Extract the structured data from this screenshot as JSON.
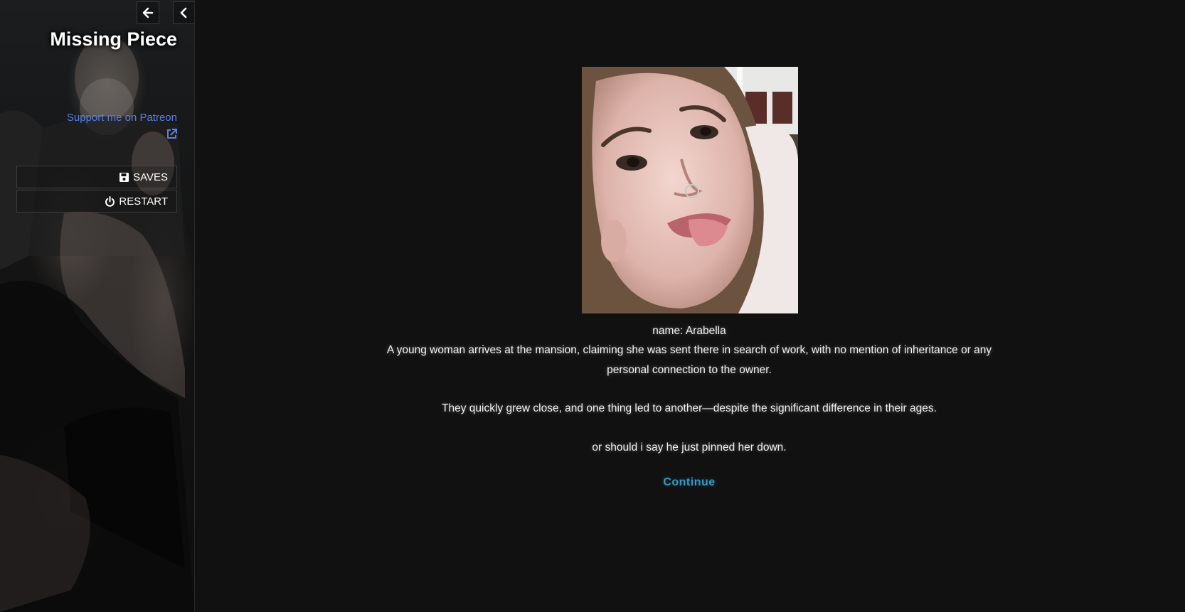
{
  "sidebar": {
    "title": "Missing Piece",
    "patreon_link": "Support me on Patreon",
    "menu": {
      "saves_label": "SAVES",
      "restart_label": "RESTART"
    },
    "icons": {
      "back": "arrow-left-icon",
      "collapse": "chevron-left-icon",
      "external_link": "external-link-icon",
      "saves": "floppy-disk-icon",
      "restart": "power-icon"
    }
  },
  "passage": {
    "name_line": "name: Arabella",
    "paragraphs": [
      "A young woman arrives at the mansion, claiming she was sent there in search of work, with no mention of inheritance or any personal connection to the owner.",
      "They quickly grew close, and one thing led to another—despite the significant difference in their ages.",
      "or should i say he just pinned her down."
    ],
    "continue_label": "Continue"
  },
  "colors": {
    "background": "#111111",
    "link_blue": "#5a7fe0",
    "continue_blue": "#3a96c2",
    "text": "#f2f2f2"
  }
}
